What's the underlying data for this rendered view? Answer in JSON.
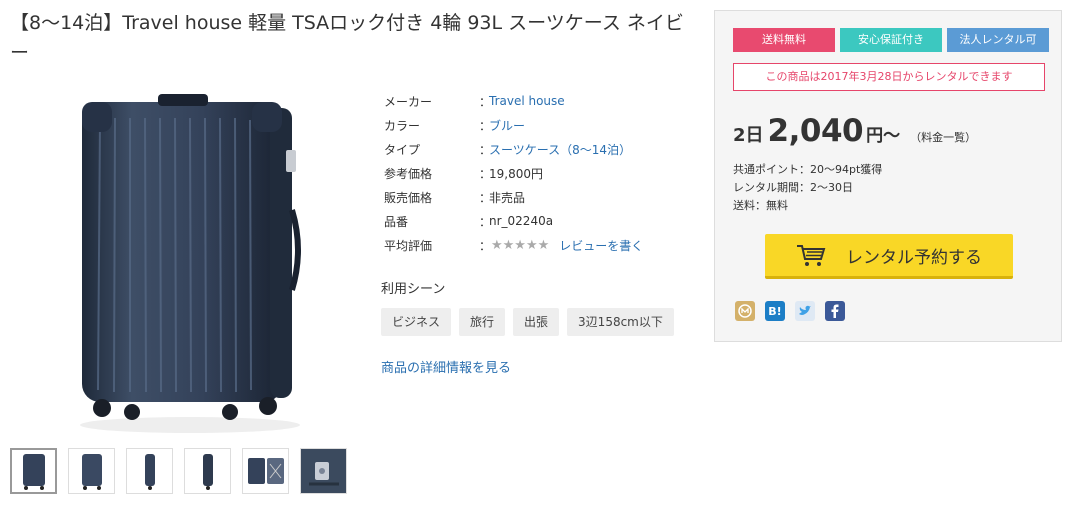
{
  "product": {
    "title": "【8〜14泊】Travel house 軽量 TSAロック付き 4輪 93L スーツケース ネイビー"
  },
  "specs": {
    "colon": "：",
    "maker_label": "メーカー",
    "maker_value": "Travel house",
    "color_label": "カラー",
    "color_value": "ブルー",
    "type_label": "タイプ",
    "type_value": "スーツケース（8〜14泊）",
    "ref_price_label": "参考価格",
    "ref_price_value": "19,800円",
    "sale_price_label": "販売価格",
    "sale_price_value": "非売品",
    "sku_label": "品番",
    "sku_value": "nr_02240a",
    "rating_label": "平均評価",
    "rating_stars": "★★★★★",
    "review_link": "レビューを書く"
  },
  "scenes": {
    "title": "利用シーン",
    "tags": [
      "ビジネス",
      "旅行",
      "出張",
      "3辺158cm以下"
    ]
  },
  "detail_link": "商品の詳細情報を見る",
  "panel": {
    "badges": [
      {
        "label": "送料無料",
        "color": "#e84a6f"
      },
      {
        "label": "安心保証付き",
        "color": "#3cc8c0"
      },
      {
        "label": "法人レンタル可",
        "color": "#5b9bd5"
      }
    ],
    "notice": "この商品は2017年3月28日からレンタルできます",
    "price_days": "2日",
    "price_amount": "2,040",
    "price_unit": "円〜",
    "price_list_link": "（料金一覧）",
    "points": "共通ポイント：20〜94pt獲得",
    "rental_period": "レンタル期間：2〜30日",
    "shipping": "送料：無料",
    "cta_label": "レンタル予約する"
  },
  "social": {
    "icons": [
      "mixi-check-icon",
      "hatena-bookmark-icon",
      "twitter-icon",
      "facebook-icon"
    ],
    "hatena_text": "B!"
  },
  "colors": {
    "link": "#2a6fb0",
    "cta": "#f9d726",
    "suitcase": "#2e3a4e"
  }
}
